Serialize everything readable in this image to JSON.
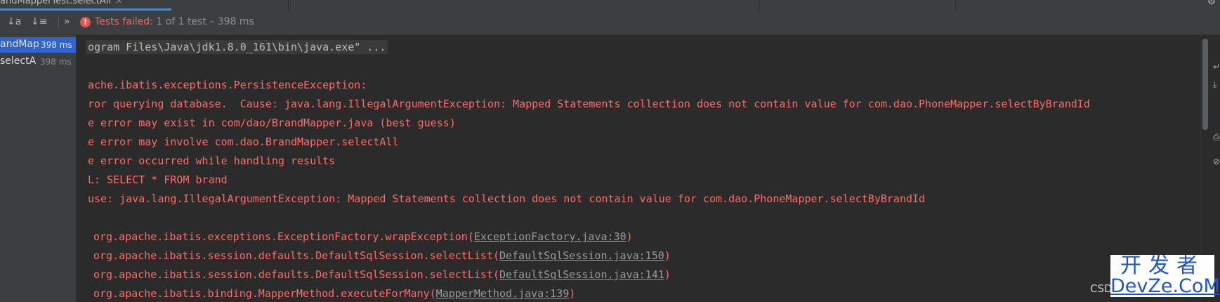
{
  "tab": {
    "title": "andMapperTest.selectAll",
    "close": "×"
  },
  "toolbar": {
    "sort_alpha_icon": "↓a",
    "sort_duration_icon": "↓≡",
    "more_icon": "»",
    "status_icon": "!",
    "status_failed": "Tests failed:",
    "status_detail": " 1 of 1 test – 398 ms"
  },
  "tree": {
    "items": [
      {
        "name": "andMap",
        "time": "398 ms"
      },
      {
        "name": "selectA",
        "time": "398 ms"
      }
    ]
  },
  "console": {
    "command": "ogram Files\\Java\\jdk1.8.0_161\\bin\\java.exe\" ...",
    "errors": [
      "ache.ibatis.exceptions.PersistenceException:",
      "ror querying database.  Cause: java.lang.IllegalArgumentException: Mapped Statements collection does not contain value for com.dao.PhoneMapper.selectByBrandId",
      "e error may exist in com/dao/BrandMapper.java (best guess)",
      "e error may involve com.dao.BrandMapper.selectAll",
      "e error occurred while handling results",
      "L: SELECT * FROM brand",
      "use: java.lang.IllegalArgumentException: Mapped Statements collection does not contain value for com.dao.PhoneMapper.selectByBrandId"
    ],
    "stack": [
      {
        "prefix": "org.apache.ibatis.exceptions.ExceptionFactory.wrapException(",
        "link": "ExceptionFactory.java:30",
        "suffix": ")"
      },
      {
        "prefix": "org.apache.ibatis.session.defaults.DefaultSqlSession.selectList(",
        "link": "DefaultSqlSession.java:150",
        "suffix": ")"
      },
      {
        "prefix": "org.apache.ibatis.session.defaults.DefaultSqlSession.selectList(",
        "link": "DefaultSqlSession.java:141",
        "suffix": ")"
      },
      {
        "prefix": "org.apache.ibatis.binding.MapperMethod.executeForMany(",
        "link": "MapperMethod.java:139",
        "suffix": ")"
      }
    ]
  },
  "watermark": {
    "csd": "CSD",
    "top": "开发者",
    "bottom": "DevZe.CoM"
  },
  "colors": {
    "error": "#ff6b68",
    "accent": "#2f65ca",
    "failed": "#e06c6c"
  }
}
